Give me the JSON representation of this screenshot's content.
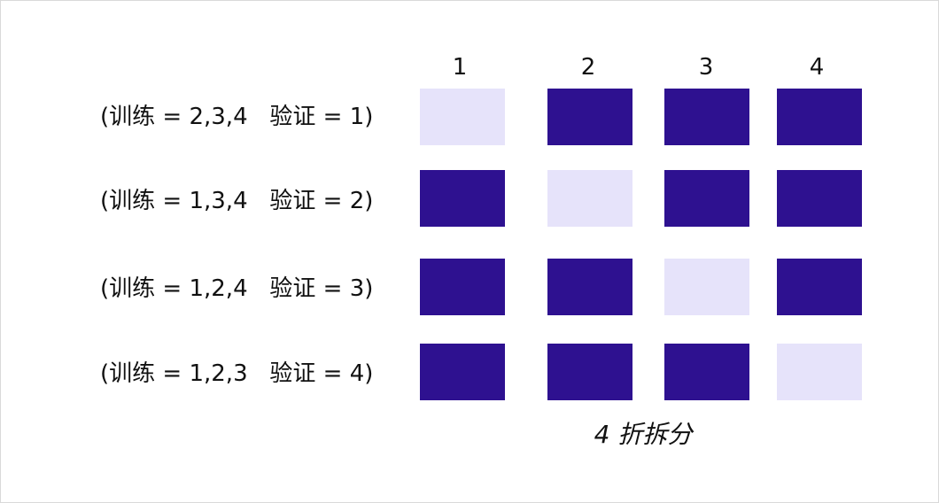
{
  "columns": [
    "1",
    "2",
    "3",
    "4"
  ],
  "rows": [
    {
      "label": "(训练 = 2,3,4   验证 = 1)",
      "validation_fold": 1
    },
    {
      "label": "(训练 = 1,3,4   验证 = 2)",
      "validation_fold": 2
    },
    {
      "label": "(训练 = 1,2,4   验证 = 3)",
      "validation_fold": 3
    },
    {
      "label": "(训练 = 1,2,3   验证 = 4)",
      "validation_fold": 4
    }
  ],
  "caption": "4 折拆分",
  "colors": {
    "training": "#2e1190",
    "validation": "#e6e3fa",
    "border": "#d9d9d9",
    "text": "#111111"
  }
}
